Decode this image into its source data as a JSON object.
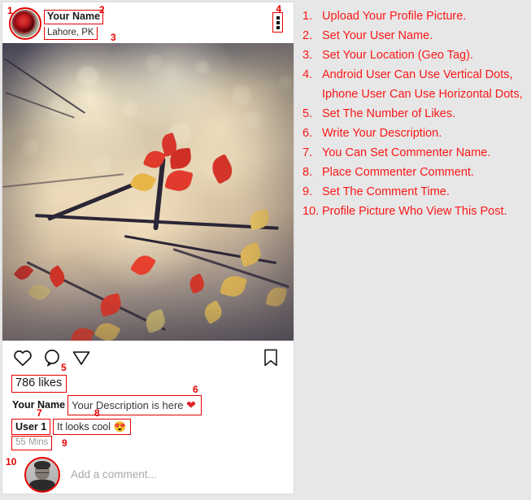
{
  "theme": {
    "page_bg": "#e7e7e7",
    "card_bg": "#ffffff",
    "annotation_red": "#e50000",
    "instruction_red": "#fb1818",
    "muted_text": "#9a9a9a"
  },
  "post": {
    "header": {
      "avatar_icon": "rose-profile-picture",
      "user_name": "Your Name",
      "location": "Lahore, PK",
      "menu_icon": "vertical-dots-icon"
    },
    "photo": {
      "alt": "autumn red leaves on branch with bokeh background"
    },
    "actions": {
      "like_icon": "heart-outline-icon",
      "comment_icon": "comment-bubble-icon",
      "share_icon": "paper-plane-icon",
      "save_icon": "bookmark-outline-icon"
    },
    "likes": "786 likes",
    "caption": {
      "author": "Your Name",
      "text": "Your Description is here",
      "emoji": "❤"
    },
    "comment": {
      "user": "User 1",
      "text": "It looks cool",
      "emoji": "😍",
      "time": "55 Mins"
    },
    "add_comment": {
      "avatar_icon": "viewer-profile-picture",
      "placeholder": "Add a comment..."
    }
  },
  "annotations": {
    "n1": "1",
    "n2": "2",
    "n3": "3",
    "n4": "4",
    "n5": "5",
    "n6": "6",
    "n7": "7",
    "n8": "8",
    "n9": "9",
    "n10": "10"
  },
  "instructions": [
    {
      "num": "1.",
      "text": "Upload Your Profile Picture."
    },
    {
      "num": "2.",
      "text": "Set Your User Name."
    },
    {
      "num": "3.",
      "text": "Set Your Location (Geo Tag)."
    },
    {
      "num": "4.",
      "text": "Android User Can Use Vertical Dots,",
      "cont": "Iphone User Can Use Horizontal Dots,"
    },
    {
      "num": "5.",
      "text": "Set The Number of Likes."
    },
    {
      "num": "6.",
      "text": "Write Your Description."
    },
    {
      "num": "7.",
      "text": "You Can Set Commenter Name."
    },
    {
      "num": "8.",
      "text": "Place Commenter Comment."
    },
    {
      "num": "9.",
      "text": "Set The Comment Time."
    },
    {
      "num": "10.",
      "text": "Profile Picture Who View This Post."
    }
  ]
}
